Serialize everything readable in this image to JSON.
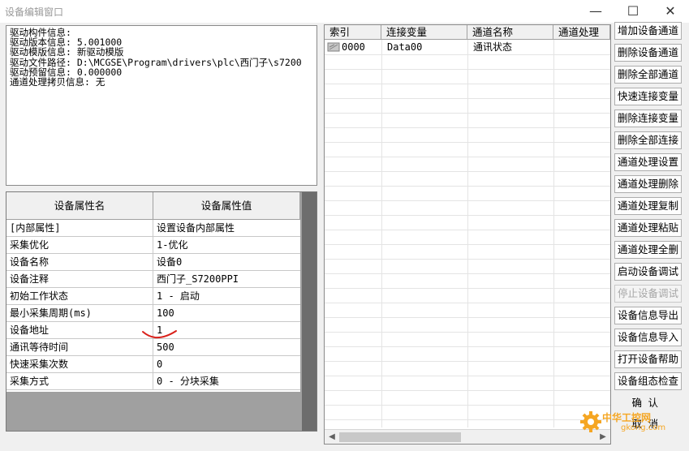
{
  "window": {
    "title": "设备编辑窗口",
    "min_glyph": "—",
    "max_glyph": "☐",
    "close_glyph": "✕"
  },
  "info": {
    "lines": [
      "驱动构件信息:",
      "驱动版本信息: 5.001000",
      "驱动模版信息: 新驱动模版",
      "驱动文件路径: D:\\MCGSE\\Program\\drivers\\plc\\西门子\\s7200",
      "驱动预留信息: 0.000000",
      "通道处理拷贝信息: 无"
    ]
  },
  "props": {
    "headers": [
      "设备属性名",
      "设备属性值"
    ],
    "rows": [
      {
        "name": "[内部属性]",
        "value": "设置设备内部属性"
      },
      {
        "name": "采集优化",
        "value": "1-优化"
      },
      {
        "name": "设备名称",
        "value": "设备0"
      },
      {
        "name": "设备注释",
        "value": "西门子_S7200PPI"
      },
      {
        "name": "初始工作状态",
        "value": "1 - 启动"
      },
      {
        "name": "最小采集周期(ms)",
        "value": "100"
      },
      {
        "name": "设备地址",
        "value": "1"
      },
      {
        "name": "通讯等待时间",
        "value": "500"
      },
      {
        "name": "快速采集次数",
        "value": "0"
      },
      {
        "name": "采集方式",
        "value": "0 - 分块采集"
      }
    ]
  },
  "channels": {
    "headers": [
      "索引",
      "连接变量",
      "通道名称",
      "通道处理"
    ],
    "rows": [
      {
        "index": "0000",
        "variable": "Data00",
        "name": "通讯状态",
        "process": ""
      }
    ]
  },
  "buttons": [
    {
      "label": "增加设备通道",
      "enabled": true
    },
    {
      "label": "删除设备通道",
      "enabled": true
    },
    {
      "label": "删除全部通道",
      "enabled": true
    },
    {
      "label": "快速连接变量",
      "enabled": true
    },
    {
      "label": "删除连接变量",
      "enabled": true
    },
    {
      "label": "删除全部连接",
      "enabled": true
    },
    {
      "label": "通道处理设置",
      "enabled": true
    },
    {
      "label": "通道处理删除",
      "enabled": true
    },
    {
      "label": "通道处理复制",
      "enabled": true
    },
    {
      "label": "通道处理粘贴",
      "enabled": true
    },
    {
      "label": "通道处理全删",
      "enabled": true
    },
    {
      "label": "启动设备调试",
      "enabled": true
    },
    {
      "label": "停止设备调试",
      "enabled": false
    },
    {
      "label": "设备信息导出",
      "enabled": true
    },
    {
      "label": "设备信息导入",
      "enabled": true
    },
    {
      "label": "打开设备帮助",
      "enabled": true
    },
    {
      "label": "设备组态检查",
      "enabled": true
    }
  ],
  "ok_label": "确认",
  "cancel_label": "取消",
  "watermark": {
    "text": "中华工控网",
    "url": "gkong.com"
  },
  "colors": {
    "annotation": "#d9201a",
    "watermark": "#f5a623",
    "disabled": "#a6a6a6"
  }
}
